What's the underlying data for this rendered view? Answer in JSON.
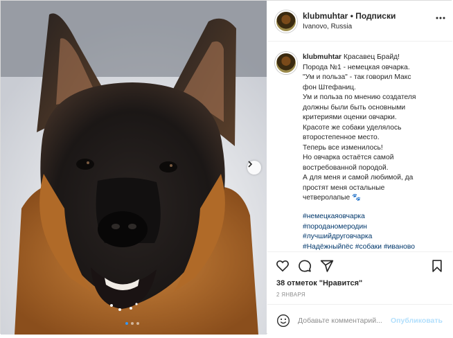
{
  "post": {
    "username": "klubmuhtar",
    "separator": "•",
    "follow_label": "Подписки",
    "location": "Ivanovo, Russia",
    "caption_lines": [
      "Красавец Брайд!",
      "Порода №1 - немецкая овчарка.",
      "\"Ум и польза\" - так говорил Макс",
      "фон Штефаниц.",
      "Ум и польза по мнению создателя",
      "должны были быть основными",
      "критериями оценки овчарки.",
      "Красоте же собаки уделялось",
      "второстепенное место.",
      "Теперь все изменилось!",
      "Но овчарка остаётся самой",
      "востребованной породой.",
      "А для меня и самой любимой, да",
      "простят меня остальные",
      "четверолапые 🐾"
    ],
    "hashtags": [
      "#немецкаяовчарка",
      "#породаномеродин",
      "#лучшийдруговчарка",
      "#Надёжныйпёс",
      "#собаки",
      "#иваново"
    ],
    "likes_text": "38 отметок \"Нравится\"",
    "date_text": "2 ЯНВАРЯ",
    "comment_placeholder": "Добавьте комментарий...",
    "publish_label": "Опубликовать"
  },
  "icons": {
    "like": "heart-icon",
    "comment": "comment-icon",
    "share": "share-icon",
    "save": "bookmark-icon",
    "more": "more-options-icon",
    "emoji": "smile-icon",
    "next": "chevron-right-icon"
  },
  "carousel": {
    "slide_count": 3,
    "active_slide": 1
  },
  "colors": {
    "hashtag": "#00376b",
    "publish_disabled": "#b2dffc",
    "meta_gray": "#8e8e8e",
    "active_dot": "#3897f0"
  }
}
